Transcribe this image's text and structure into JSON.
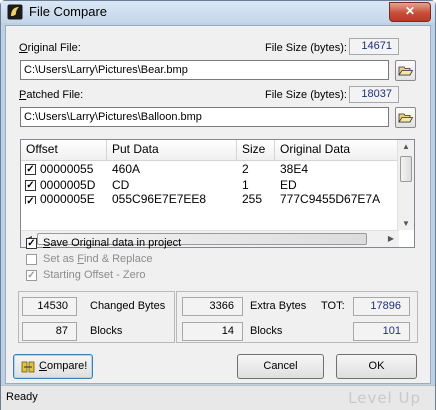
{
  "window": {
    "title": "File Compare",
    "close_glyph": "✕"
  },
  "original": {
    "label_underline": "O",
    "label_rest": "riginal File:",
    "size_label": "File Size (bytes):",
    "size_value": "14671",
    "path": "C:\\Users\\Larry\\Pictures\\Bear.bmp"
  },
  "patched": {
    "label_underline": "P",
    "label_rest": "atched File:",
    "size_label": "File Size (bytes):",
    "size_value": "18037",
    "path": "C:\\Users\\Larry\\Pictures\\Balloon.bmp"
  },
  "table": {
    "columns": [
      "Offset",
      "Put Data",
      "Size",
      "Original Data"
    ],
    "rows": [
      {
        "checked": true,
        "offset": "00000055",
        "put_data": "460A",
        "size": "2",
        "original": "38E4"
      },
      {
        "checked": true,
        "offset": "0000005D",
        "put_data": "CD",
        "size": "1",
        "original": "ED"
      },
      {
        "checked": true,
        "offset": "0000005E",
        "put_data": "055C96E7E7EE8",
        "size": "255",
        "original": "777C9455D67E7A"
      }
    ]
  },
  "options": {
    "save_original": {
      "pre": "",
      "underline": "S",
      "post": "ave Original data in project",
      "checked": true,
      "enabled": true
    },
    "find_replace": {
      "pre": "Set as ",
      "underline": "F",
      "post": "ind & Replace",
      "checked": false,
      "enabled": false
    },
    "starting_offset": {
      "pre": "Starting Offset - Zero",
      "underline": "",
      "post": "",
      "checked": true,
      "enabled": false
    }
  },
  "stats": {
    "changed_bytes_value": "14530",
    "changed_bytes_label": "Changed Bytes",
    "blocks_left_value": "87",
    "blocks_left_label": "Blocks",
    "extra_bytes_value": "3366",
    "extra_bytes_label": "Extra Bytes",
    "blocks_right_value": "14",
    "blocks_right_label": "Blocks",
    "tot_label": "TOT:",
    "tot_bytes": "17896",
    "tot_blocks": "101"
  },
  "buttons": {
    "compare_underline": "C",
    "compare_rest": "ompare!",
    "cancel": "Cancel",
    "ok": "OK"
  },
  "status": {
    "text": "Ready",
    "watermark": "Level Up"
  }
}
